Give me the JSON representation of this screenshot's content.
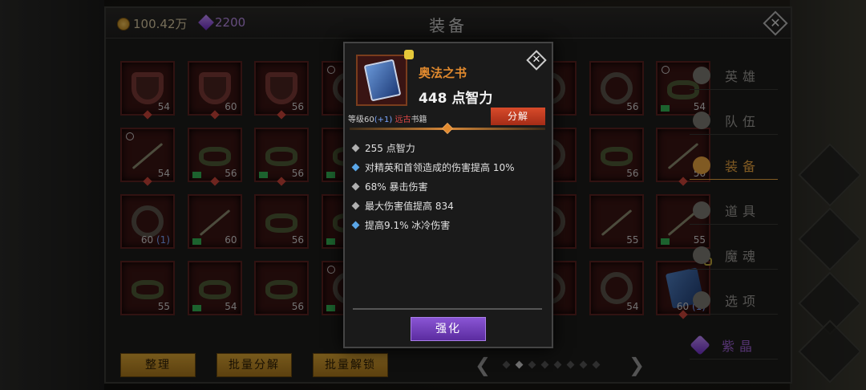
{
  "currency": {
    "gold": "100.42万",
    "gems": "2200"
  },
  "title": "装备",
  "slots": [
    {
      "type": "shield",
      "level": "54",
      "rarity": true
    },
    {
      "type": "shield",
      "level": "60",
      "rarity": true
    },
    {
      "type": "shield",
      "level": "56",
      "rarity": true
    },
    {
      "type": "ring",
      "level": "",
      "rarity": false,
      "yin": true
    },
    {
      "type": "ring",
      "level": "",
      "rarity": false
    },
    {
      "type": "ring",
      "level": "",
      "rarity": false
    },
    {
      "type": "ring",
      "level": "",
      "rarity": false
    },
    {
      "type": "ring",
      "level": "56",
      "rarity": false
    },
    {
      "type": "belt",
      "level": "54",
      "rarity": false,
      "book": true,
      "mark": true
    },
    {
      "type": "arrow",
      "level": "54",
      "rarity": true,
      "mark": true
    },
    {
      "type": "belt",
      "level": "56",
      "rarity": true,
      "book": true
    },
    {
      "type": "belt",
      "level": "56",
      "rarity": true,
      "book": true
    },
    {
      "type": "belt",
      "level": "",
      "rarity": false,
      "book": true
    },
    {
      "type": "ring",
      "level": "",
      "rarity": false
    },
    {
      "type": "ring",
      "level": "",
      "rarity": false
    },
    {
      "type": "ring",
      "level": "",
      "rarity": false
    },
    {
      "type": "belt",
      "level": "56",
      "rarity": false
    },
    {
      "type": "arrow",
      "level": "56",
      "rarity": true
    },
    {
      "type": "ring",
      "level": "60",
      "plus": "(1)",
      "rarity": false
    },
    {
      "type": "arrow",
      "level": "60",
      "rarity": false,
      "book": true
    },
    {
      "type": "belt",
      "level": "56",
      "rarity": false
    },
    {
      "type": "belt",
      "level": "",
      "rarity": false,
      "book": true,
      "lock": true
    },
    {
      "type": "ring",
      "level": "",
      "rarity": false
    },
    {
      "type": "ring",
      "level": "",
      "rarity": false
    },
    {
      "type": "ring",
      "level": "",
      "rarity": false
    },
    {
      "type": "arrow",
      "level": "55",
      "rarity": false
    },
    {
      "type": "arrow",
      "level": "55",
      "rarity": false,
      "book": true
    },
    {
      "type": "belt",
      "level": "55",
      "rarity": false
    },
    {
      "type": "belt",
      "level": "54",
      "rarity": false,
      "book": true
    },
    {
      "type": "belt",
      "level": "56",
      "rarity": false
    },
    {
      "type": "ring",
      "level": "",
      "rarity": false,
      "yin": true,
      "book": true
    },
    {
      "type": "ring",
      "level": "",
      "rarity": false
    },
    {
      "type": "ring",
      "level": "",
      "rarity": false
    },
    {
      "type": "ring",
      "level": "",
      "rarity": false
    },
    {
      "type": "ring",
      "level": "54",
      "rarity": false
    },
    {
      "type": "bookicon",
      "level": "60",
      "plus": "(1)",
      "rarity": true,
      "lock": true
    }
  ],
  "buttons": {
    "sort": "整理",
    "batch_dismantle": "批量分解",
    "batch_unlock": "批量解锁"
  },
  "menu": [
    {
      "label": "英雄",
      "active": false
    },
    {
      "label": "队伍",
      "active": false
    },
    {
      "label": "装备",
      "active": true
    },
    {
      "label": "道具",
      "active": false
    },
    {
      "label": "魔魂",
      "active": false
    },
    {
      "label": "选项",
      "active": false
    },
    {
      "label": "紫晶",
      "active": false,
      "gem": true
    }
  ],
  "popup": {
    "name": "奥法之书",
    "main_stat": "448 点智力",
    "level_label": "等级60",
    "level_plus": "(+1)",
    "quality": "远古",
    "category": "书籍",
    "dismantle": "分解",
    "attributes": [
      {
        "text": "255 点智力",
        "color": "#b0b0b0"
      },
      {
        "text": "对精英和首领造成的伤害提高 10%",
        "color": "#5aa6e8"
      },
      {
        "text": "68% 暴击伤害",
        "color": "#b0b0b0"
      },
      {
        "text": "最大伤害值提高 834",
        "color": "#b0b0b0"
      },
      {
        "text": "提高9.1% 冰冷伤害",
        "color": "#5aa6e8"
      }
    ],
    "enhance": "强化"
  },
  "pager": {
    "pages": 8,
    "current": 1
  }
}
